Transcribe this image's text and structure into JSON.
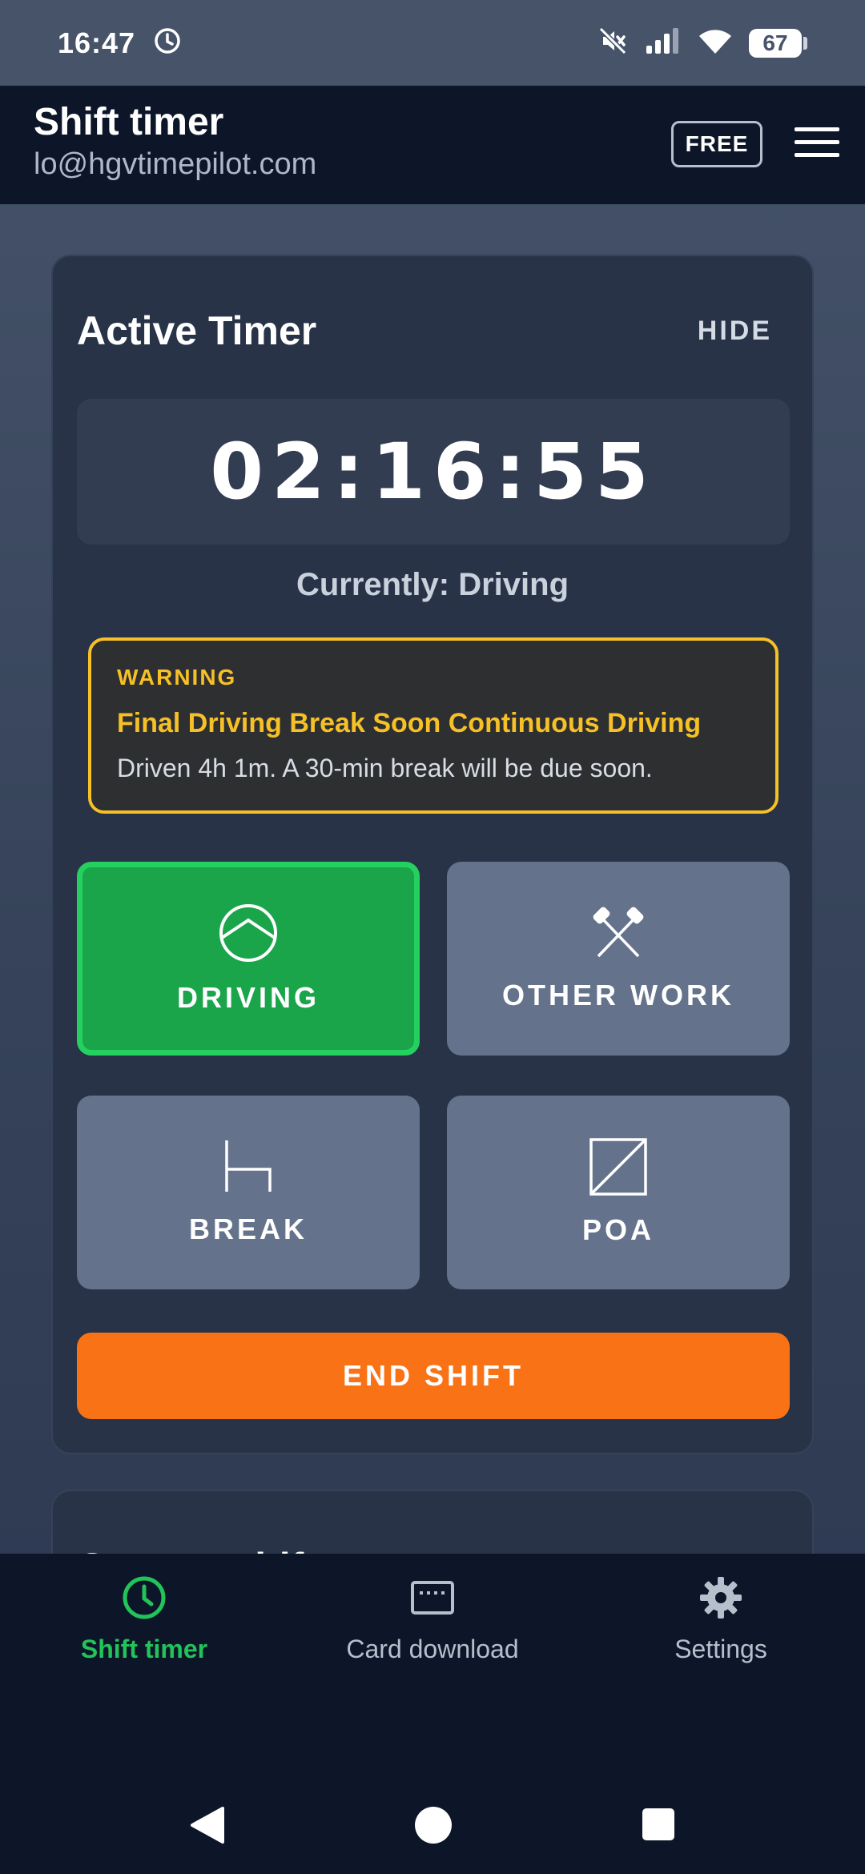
{
  "status_bar": {
    "time": "16:47",
    "battery": "67",
    "icons": [
      "alarm-icon",
      "mute-icon",
      "signal-icon",
      "wifi-icon",
      "battery-icon"
    ]
  },
  "app_bar": {
    "title": "Shift timer",
    "email": "lo@hgvtimepilot.com",
    "plan_badge": "FREE",
    "menu_icon": "hamburger-menu-icon"
  },
  "active_timer": {
    "title": "Active Timer",
    "hide_label": "HIDE",
    "clock": "02:16:55",
    "currently": "Currently: Driving",
    "warning": {
      "label": "WARNING",
      "heading": "Final Driving Break Soon Continuous Driving",
      "text": "Driven 4h 1m. A 30-min break will be due soon."
    },
    "modes": [
      {
        "label": "DRIVING",
        "icon": "steering-wheel-icon",
        "active": true
      },
      {
        "label": "OTHER WORK",
        "icon": "crossed-hammers-icon",
        "active": false
      },
      {
        "label": "BREAK",
        "icon": "bed-icon",
        "active": false
      },
      {
        "label": "POA",
        "icon": "availability-box-icon",
        "active": false
      }
    ],
    "end_shift_label": "END SHIFT"
  },
  "next_card": {
    "title_partial": "Current shif"
  },
  "bottom_nav": {
    "items": [
      {
        "label": "Shift timer",
        "icon": "clock-icon",
        "active": true
      },
      {
        "label": "Card download",
        "icon": "card-reader-icon",
        "active": false
      },
      {
        "label": "Settings",
        "icon": "gear-icon",
        "active": false
      }
    ]
  },
  "colors": {
    "accent_green": "#22c35a",
    "warning_yellow": "#f6c026",
    "end_shift_orange": "#f97316",
    "mode_button": "#64738b"
  }
}
